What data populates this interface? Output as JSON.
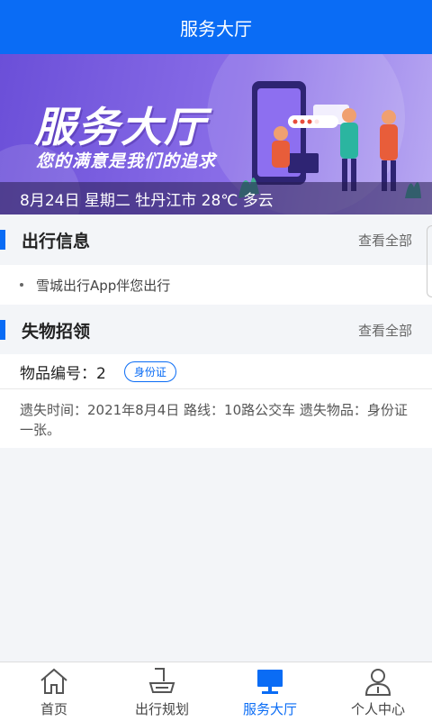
{
  "header": {
    "title": "服务大厅"
  },
  "banner": {
    "title": "服务大厅",
    "subtitle": "您的满意是我们的追求",
    "status": "8月24日 星期二 牡丹江市 28℃ 多云"
  },
  "travel": {
    "title": "出行信息",
    "more": "查看全部",
    "items": [
      {
        "text": "雪城出行App伴您出行"
      }
    ]
  },
  "lost": {
    "title": "失物招领",
    "more": "查看全部",
    "item_number": "物品编号：2",
    "tag": "身份证",
    "description": "遗失时间：2021年8月4日 路线：10路公交车 遗失物品：身份证一张。"
  },
  "tabs": [
    {
      "label": "首页",
      "icon": "home-icon"
    },
    {
      "label": "出行规划",
      "icon": "route-icon"
    },
    {
      "label": "服务大厅",
      "icon": "monitor-icon",
      "active": true
    },
    {
      "label": "个人中心",
      "icon": "user-icon"
    }
  ],
  "colors": {
    "primary": "#0a6cf5",
    "banner_start": "#6b4fd8",
    "banner_end": "#b9a9f2"
  }
}
